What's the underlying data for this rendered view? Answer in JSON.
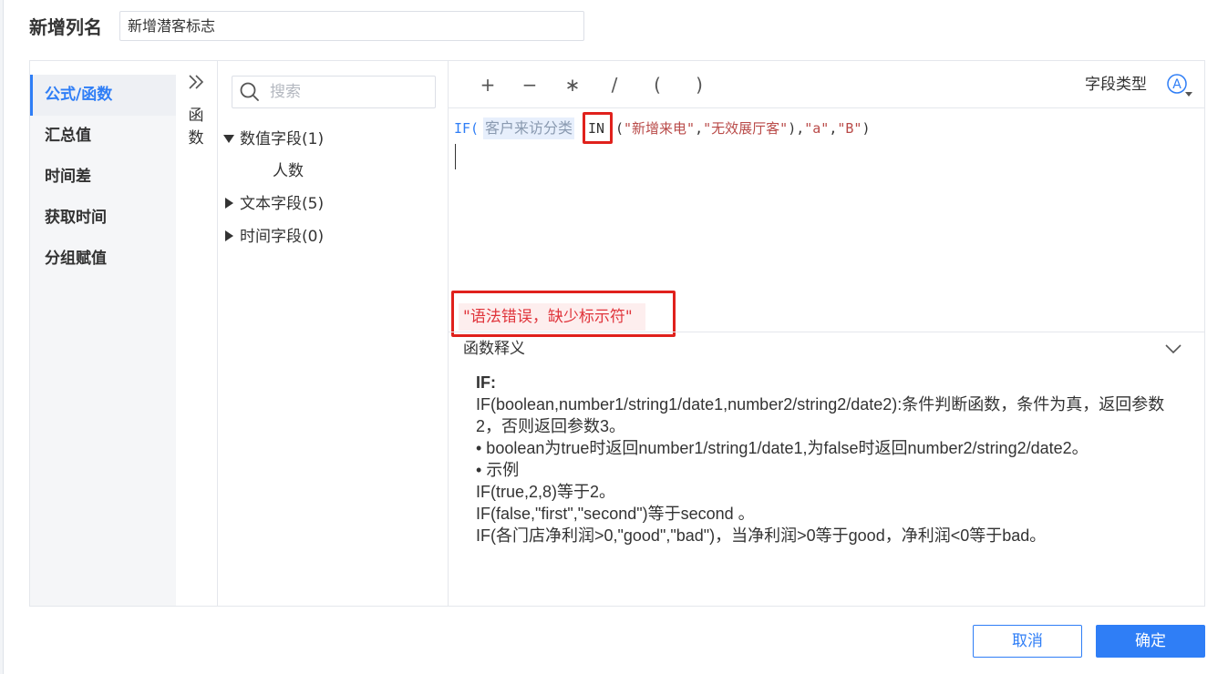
{
  "header": {
    "label": "新增列名",
    "input_value": "新增潜客标志"
  },
  "sidebar": {
    "items": [
      {
        "label": "公式/函数",
        "active": true
      },
      {
        "label": "汇总值"
      },
      {
        "label": "时间差"
      },
      {
        "label": "获取时间"
      },
      {
        "label": "分组赋值"
      }
    ]
  },
  "function_panel": {
    "label_line1": "函",
    "label_line2": "数",
    "expand_icon": "double-chevron-right-icon"
  },
  "fields": {
    "search_placeholder": "搜索",
    "groups": [
      {
        "label": "数值字段(1)",
        "expanded": true,
        "children": [
          "人数"
        ]
      },
      {
        "label": "文本字段(5)",
        "expanded": false
      },
      {
        "label": "时间字段(0)",
        "expanded": false
      }
    ]
  },
  "toolbar": {
    "operators": [
      "+",
      "−",
      "∗",
      "/",
      "(",
      ")"
    ],
    "field_type_label": "字段类型",
    "field_type_icon": "circled-a-dropdown-icon"
  },
  "formula": {
    "if_part": "IF(",
    "field_token": "客户来访分类",
    "in_keyword": "IN",
    "args_open": "(",
    "str1": "\"新增来电\"",
    "comma1": ",",
    "str2": "\"无效展厅客\"",
    "after_list": "),",
    "str3": "\"a\"",
    "comma2": ",",
    "str4": "\"B\"",
    "close": ")"
  },
  "error": {
    "message": "\"语法错误，缺少标示符\""
  },
  "explanation": {
    "title": "函数释义",
    "collapse_icon": "chevron-down-icon",
    "lines": [
      "IF:",
      "IF(boolean,number1/string1/date1,number2/string2/date2):条件判断函数，条件为真，返回参数",
      "2，否则返回参数3。",
      "• boolean为true时返回number1/string1/date1,为false时返回number2/string2/date2。",
      "• 示例",
      "IF(true,2,8)等于2。",
      "IF(false,\"first\",\"second\")等于second 。",
      "IF(各门店净利润>0,\"good\",\"bad\")，当净利润>0等于good，净利润<0等于bad。"
    ]
  },
  "footer": {
    "cancel_label": "取消",
    "ok_label": "确定"
  },
  "colors": {
    "accent": "#2f7ef6",
    "error": "#e0343b",
    "highlight_border": "#e0211c"
  }
}
